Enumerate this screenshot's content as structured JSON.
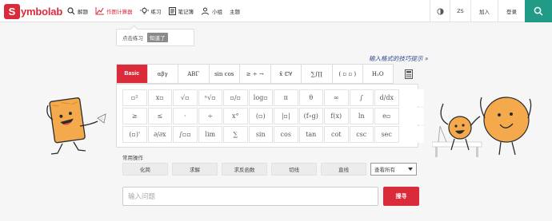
{
  "brand": {
    "logo_letter": "S",
    "logo_rest": "ymbolab",
    "color": "#db2b3b"
  },
  "nav": [
    {
      "label": "解题",
      "icon": "search-icon"
    },
    {
      "label": "作图计算器",
      "icon": "graph-icon",
      "active": true
    },
    {
      "label": "练习",
      "icon": "bulb-icon"
    },
    {
      "label": "笔记簿",
      "icon": "notebook-icon"
    },
    {
      "label": "小组",
      "icon": "group-icon"
    },
    {
      "label": "主题",
      "icon": ""
    }
  ],
  "right_nav": {
    "contrast_icon": "contrast-icon",
    "lang": "ZS",
    "join": "加入",
    "login": "登录",
    "search_icon": "search-icon"
  },
  "tip": {
    "text": "点击练习",
    "button": "知道了"
  },
  "hint": "输入格式的技巧提示 »",
  "tabs": [
    "Basic",
    "αβγ",
    "ABΓ",
    "sin cos",
    "≥ ÷ →",
    "x̄ ℂ∀",
    "∑∫∏",
    "( ▫ ▫ )",
    "H₂O",
    "calculator-icon"
  ],
  "keys": [
    [
      "▫²",
      "x▫",
      "√▫",
      "ⁿ√▫",
      "▫/▫",
      "log▫",
      "π",
      "θ",
      "∞",
      "∫",
      "d/dx",
      ""
    ],
    [
      "≥",
      "≤",
      "·",
      "÷",
      "x°",
      "(▫)",
      "|▫|",
      "(f∘g)",
      "f(x)",
      "ln",
      "e▫",
      ""
    ],
    [
      "(▫)'",
      "∂/∂x",
      "∫▫▫",
      "lim",
      "∑",
      "sin",
      "cos",
      "tan",
      "cot",
      "csc",
      "sec",
      ""
    ]
  ],
  "ops_label": "常用操作",
  "ops": [
    "化简",
    "求解",
    "求反函数",
    "切线",
    "直线"
  ],
  "ops_more": "查看所有",
  "input": {
    "placeholder": "输入问题"
  },
  "go_label": "搜寻"
}
